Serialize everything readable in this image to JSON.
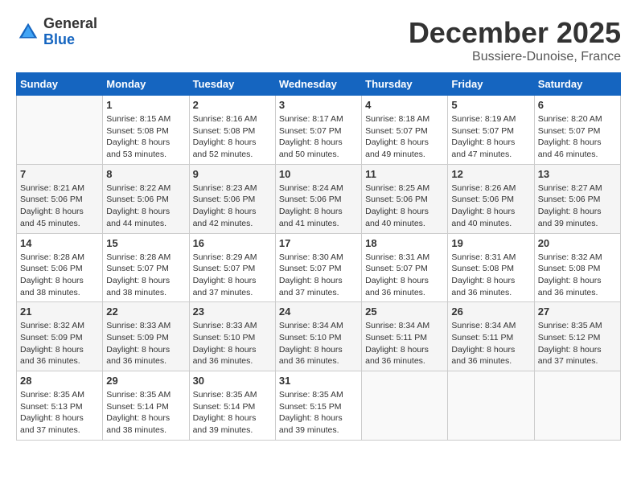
{
  "header": {
    "logo_general": "General",
    "logo_blue": "Blue",
    "month_title": "December 2025",
    "location": "Bussiere-Dunoise, France"
  },
  "weekdays": [
    "Sunday",
    "Monday",
    "Tuesday",
    "Wednesday",
    "Thursday",
    "Friday",
    "Saturday"
  ],
  "weeks": [
    [
      {
        "day": "",
        "sunrise": "",
        "sunset": "",
        "daylight": ""
      },
      {
        "day": "1",
        "sunrise": "Sunrise: 8:15 AM",
        "sunset": "Sunset: 5:08 PM",
        "daylight": "Daylight: 8 hours and 53 minutes."
      },
      {
        "day": "2",
        "sunrise": "Sunrise: 8:16 AM",
        "sunset": "Sunset: 5:08 PM",
        "daylight": "Daylight: 8 hours and 52 minutes."
      },
      {
        "day": "3",
        "sunrise": "Sunrise: 8:17 AM",
        "sunset": "Sunset: 5:07 PM",
        "daylight": "Daylight: 8 hours and 50 minutes."
      },
      {
        "day": "4",
        "sunrise": "Sunrise: 8:18 AM",
        "sunset": "Sunset: 5:07 PM",
        "daylight": "Daylight: 8 hours and 49 minutes."
      },
      {
        "day": "5",
        "sunrise": "Sunrise: 8:19 AM",
        "sunset": "Sunset: 5:07 PM",
        "daylight": "Daylight: 8 hours and 47 minutes."
      },
      {
        "day": "6",
        "sunrise": "Sunrise: 8:20 AM",
        "sunset": "Sunset: 5:07 PM",
        "daylight": "Daylight: 8 hours and 46 minutes."
      }
    ],
    [
      {
        "day": "7",
        "sunrise": "Sunrise: 8:21 AM",
        "sunset": "Sunset: 5:06 PM",
        "daylight": "Daylight: 8 hours and 45 minutes."
      },
      {
        "day": "8",
        "sunrise": "Sunrise: 8:22 AM",
        "sunset": "Sunset: 5:06 PM",
        "daylight": "Daylight: 8 hours and 44 minutes."
      },
      {
        "day": "9",
        "sunrise": "Sunrise: 8:23 AM",
        "sunset": "Sunset: 5:06 PM",
        "daylight": "Daylight: 8 hours and 42 minutes."
      },
      {
        "day": "10",
        "sunrise": "Sunrise: 8:24 AM",
        "sunset": "Sunset: 5:06 PM",
        "daylight": "Daylight: 8 hours and 41 minutes."
      },
      {
        "day": "11",
        "sunrise": "Sunrise: 8:25 AM",
        "sunset": "Sunset: 5:06 PM",
        "daylight": "Daylight: 8 hours and 40 minutes."
      },
      {
        "day": "12",
        "sunrise": "Sunrise: 8:26 AM",
        "sunset": "Sunset: 5:06 PM",
        "daylight": "Daylight: 8 hours and 40 minutes."
      },
      {
        "day": "13",
        "sunrise": "Sunrise: 8:27 AM",
        "sunset": "Sunset: 5:06 PM",
        "daylight": "Daylight: 8 hours and 39 minutes."
      }
    ],
    [
      {
        "day": "14",
        "sunrise": "Sunrise: 8:28 AM",
        "sunset": "Sunset: 5:06 PM",
        "daylight": "Daylight: 8 hours and 38 minutes."
      },
      {
        "day": "15",
        "sunrise": "Sunrise: 8:28 AM",
        "sunset": "Sunset: 5:07 PM",
        "daylight": "Daylight: 8 hours and 38 minutes."
      },
      {
        "day": "16",
        "sunrise": "Sunrise: 8:29 AM",
        "sunset": "Sunset: 5:07 PM",
        "daylight": "Daylight: 8 hours and 37 minutes."
      },
      {
        "day": "17",
        "sunrise": "Sunrise: 8:30 AM",
        "sunset": "Sunset: 5:07 PM",
        "daylight": "Daylight: 8 hours and 37 minutes."
      },
      {
        "day": "18",
        "sunrise": "Sunrise: 8:31 AM",
        "sunset": "Sunset: 5:07 PM",
        "daylight": "Daylight: 8 hours and 36 minutes."
      },
      {
        "day": "19",
        "sunrise": "Sunrise: 8:31 AM",
        "sunset": "Sunset: 5:08 PM",
        "daylight": "Daylight: 8 hours and 36 minutes."
      },
      {
        "day": "20",
        "sunrise": "Sunrise: 8:32 AM",
        "sunset": "Sunset: 5:08 PM",
        "daylight": "Daylight: 8 hours and 36 minutes."
      }
    ],
    [
      {
        "day": "21",
        "sunrise": "Sunrise: 8:32 AM",
        "sunset": "Sunset: 5:09 PM",
        "daylight": "Daylight: 8 hours and 36 minutes."
      },
      {
        "day": "22",
        "sunrise": "Sunrise: 8:33 AM",
        "sunset": "Sunset: 5:09 PM",
        "daylight": "Daylight: 8 hours and 36 minutes."
      },
      {
        "day": "23",
        "sunrise": "Sunrise: 8:33 AM",
        "sunset": "Sunset: 5:10 PM",
        "daylight": "Daylight: 8 hours and 36 minutes."
      },
      {
        "day": "24",
        "sunrise": "Sunrise: 8:34 AM",
        "sunset": "Sunset: 5:10 PM",
        "daylight": "Daylight: 8 hours and 36 minutes."
      },
      {
        "day": "25",
        "sunrise": "Sunrise: 8:34 AM",
        "sunset": "Sunset: 5:11 PM",
        "daylight": "Daylight: 8 hours and 36 minutes."
      },
      {
        "day": "26",
        "sunrise": "Sunrise: 8:34 AM",
        "sunset": "Sunset: 5:11 PM",
        "daylight": "Daylight: 8 hours and 36 minutes."
      },
      {
        "day": "27",
        "sunrise": "Sunrise: 8:35 AM",
        "sunset": "Sunset: 5:12 PM",
        "daylight": "Daylight: 8 hours and 37 minutes."
      }
    ],
    [
      {
        "day": "28",
        "sunrise": "Sunrise: 8:35 AM",
        "sunset": "Sunset: 5:13 PM",
        "daylight": "Daylight: 8 hours and 37 minutes."
      },
      {
        "day": "29",
        "sunrise": "Sunrise: 8:35 AM",
        "sunset": "Sunset: 5:14 PM",
        "daylight": "Daylight: 8 hours and 38 minutes."
      },
      {
        "day": "30",
        "sunrise": "Sunrise: 8:35 AM",
        "sunset": "Sunset: 5:14 PM",
        "daylight": "Daylight: 8 hours and 39 minutes."
      },
      {
        "day": "31",
        "sunrise": "Sunrise: 8:35 AM",
        "sunset": "Sunset: 5:15 PM",
        "daylight": "Daylight: 8 hours and 39 minutes."
      },
      {
        "day": "",
        "sunrise": "",
        "sunset": "",
        "daylight": ""
      },
      {
        "day": "",
        "sunrise": "",
        "sunset": "",
        "daylight": ""
      },
      {
        "day": "",
        "sunrise": "",
        "sunset": "",
        "daylight": ""
      }
    ]
  ]
}
